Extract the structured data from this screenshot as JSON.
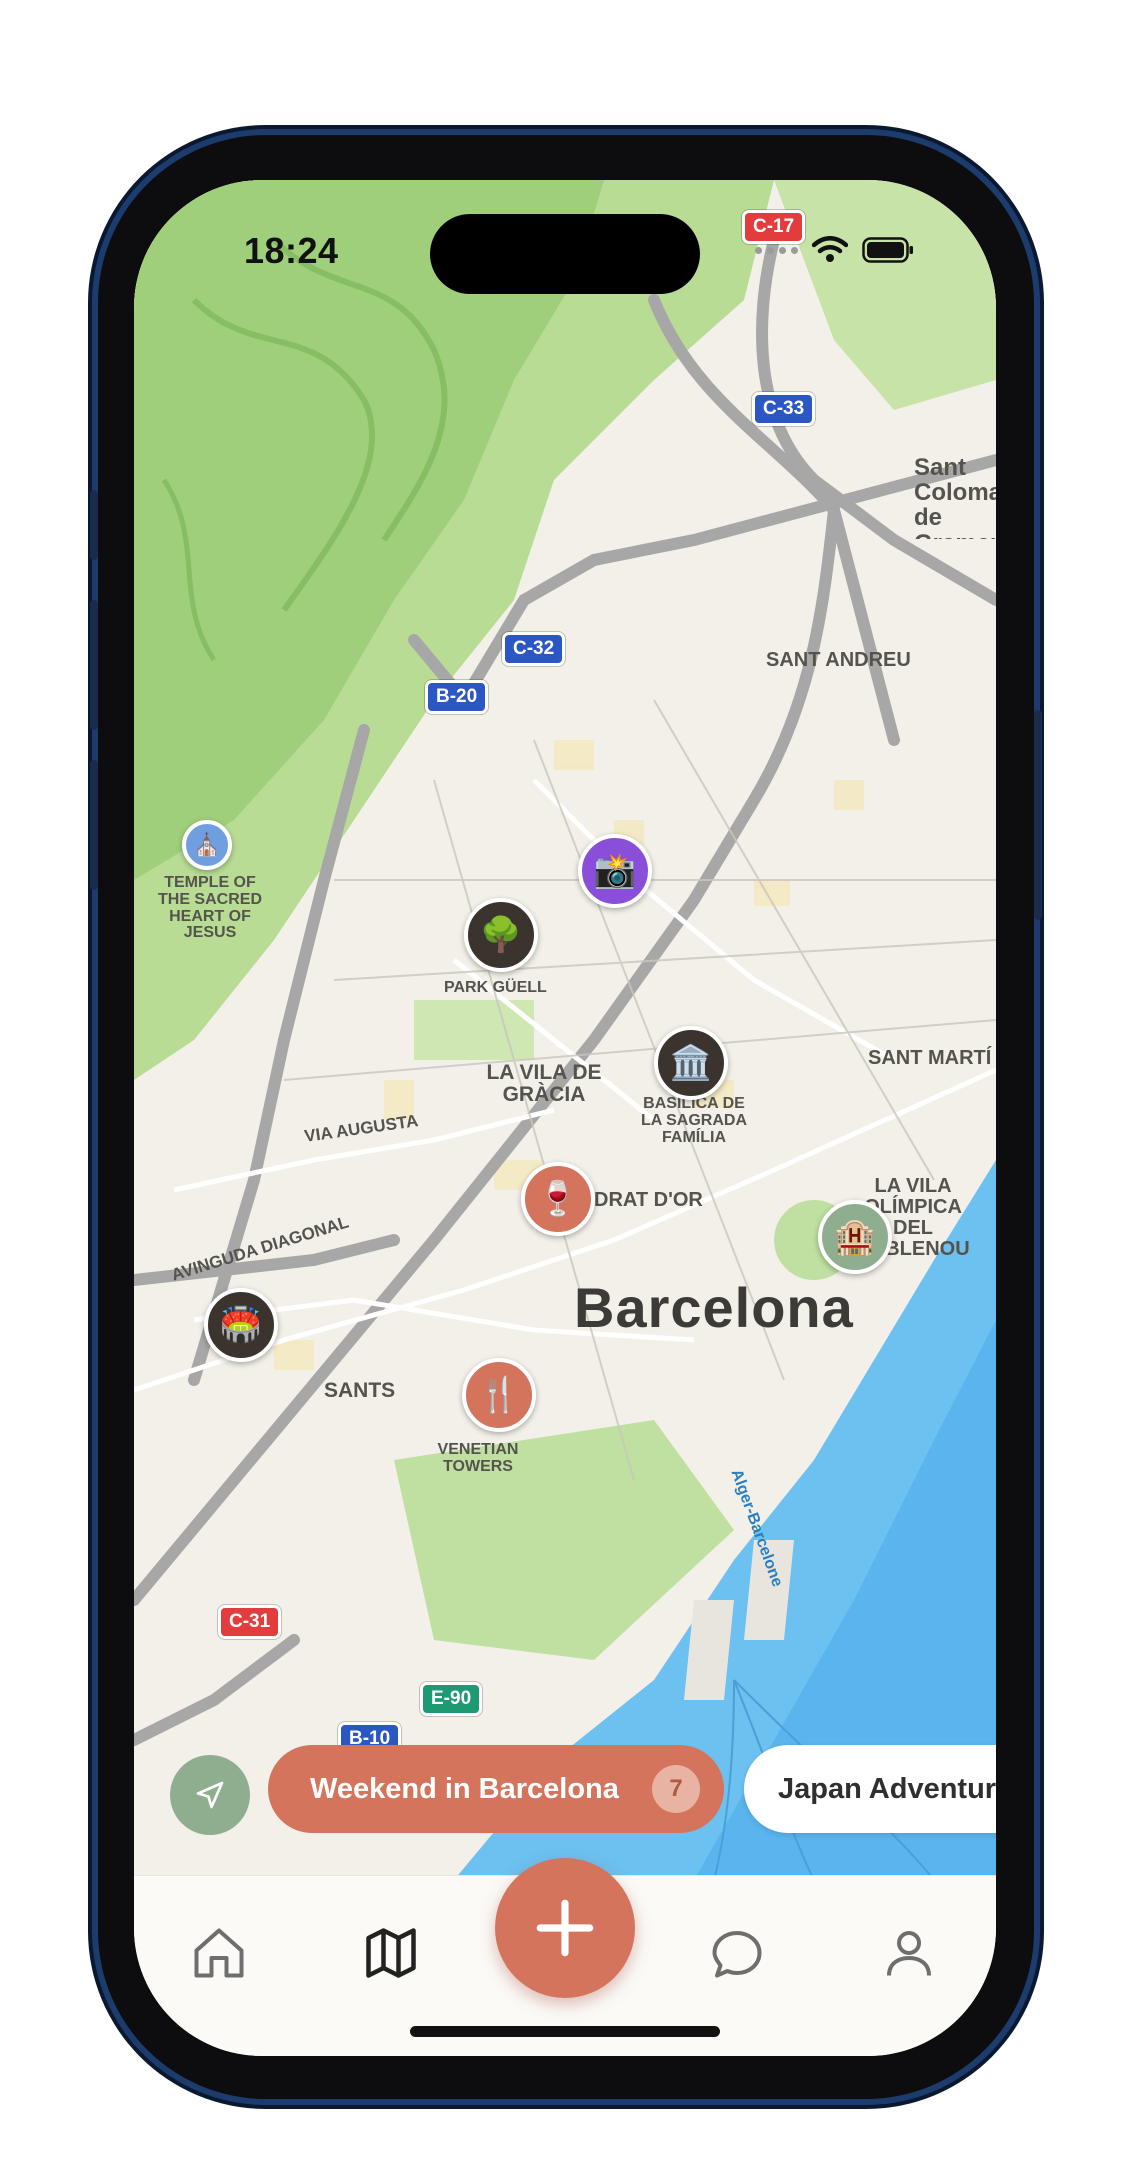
{
  "status_bar": {
    "time": "18:24"
  },
  "map": {
    "city_label": "Barcelona",
    "area_labels": [
      "SANT ANDREU",
      "TEMPLE OF THE SACRED HEART OF JESUS",
      "PARK GÜELL",
      "LA VILA DE GRÀCIA",
      "BASÍLICA DE LA SAGRADA FAMÍLIA",
      "SANT MARTÍ",
      "LA VILA OLÍMPICA DEL POBLENOU",
      "DRAT D'OR",
      "VIA AUGUSTA",
      "AVINGUDA DIAGONAL",
      "SANTS",
      "VENETIAN TOWERS",
      "Sant Coloma de Gramenet",
      "Alger-Barcelone"
    ],
    "road_shields": [
      "C-17",
      "C-33",
      "C-32",
      "B-20",
      "C-31",
      "E-90",
      "B-10"
    ],
    "pins": [
      {
        "icon": "camera-icon",
        "glyph": "📸",
        "color": "#8a4fd8"
      },
      {
        "icon": "tree-icon",
        "glyph": "🌳",
        "color": "#3a332e"
      },
      {
        "icon": "museum-icon",
        "glyph": "🏛️",
        "color": "#3a332e"
      },
      {
        "icon": "wine-icon",
        "glyph": "🍷",
        "color": "#d4745c"
      },
      {
        "icon": "hotel-icon",
        "glyph": "🏨",
        "color": "#8fae8f"
      },
      {
        "icon": "stadium-icon",
        "glyph": "🏟️",
        "color": "#3a332e"
      },
      {
        "icon": "restaurant-icon",
        "glyph": "🍴",
        "color": "#d4745c"
      },
      {
        "icon": "church-icon",
        "glyph": "⛪",
        "color": "#6f9fe0"
      }
    ]
  },
  "chips": {
    "active": {
      "label": "Weekend in Barcelona",
      "count": "7"
    },
    "other": {
      "label": "Japan Adventure"
    }
  },
  "tabbar": {
    "items": [
      "home",
      "map",
      "add",
      "chat",
      "profile"
    ],
    "accent": "#d4745c"
  }
}
